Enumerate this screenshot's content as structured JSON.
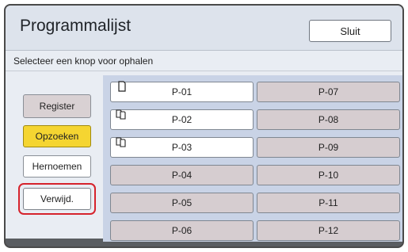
{
  "window": {
    "title": "Programmalijst",
    "close_label": "Sluit"
  },
  "prompt": "Selecteer een knop voor ophalen",
  "actions": {
    "register": "Register",
    "search": "Opzoeken",
    "rename": "Hernoemen",
    "delete": "Verwijd."
  },
  "programs": [
    {
      "label": "P-01",
      "icon": "single-page-icon"
    },
    {
      "label": "P-02",
      "icon": "multi-page-icon"
    },
    {
      "label": "P-03",
      "icon": "multi-page-icon"
    },
    {
      "label": "P-04"
    },
    {
      "label": "P-05"
    },
    {
      "label": "P-06"
    },
    {
      "label": "P-07"
    },
    {
      "label": "P-08"
    },
    {
      "label": "P-09"
    },
    {
      "label": "P-10"
    },
    {
      "label": "P-11"
    },
    {
      "label": "P-12"
    }
  ],
  "colors": {
    "search_active": "#f5d531",
    "delete_highlight": "#d6232c",
    "program_empty": "#d6cdd0",
    "program_filled": "#ffffff"
  }
}
